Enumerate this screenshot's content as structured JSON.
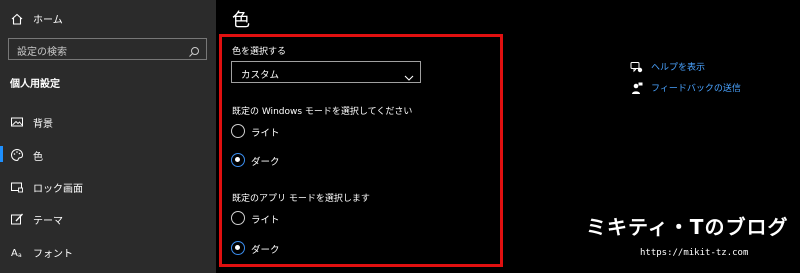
{
  "sidebar": {
    "home_label": "ホーム",
    "search_placeholder": "設定の検索",
    "section_title": "個人用設定",
    "items": [
      {
        "label": "背景",
        "icon": "image-icon"
      },
      {
        "label": "色",
        "icon": "palette-icon",
        "active": true
      },
      {
        "label": "ロック画面",
        "icon": "lock-screen-icon"
      },
      {
        "label": "テーマ",
        "icon": "theme-brush-icon"
      },
      {
        "label": "フォント",
        "icon": "font-icon"
      }
    ]
  },
  "main": {
    "title": "色",
    "choose_color_label": "色を選択する",
    "choose_color_value": "カスタム",
    "windows_mode_label": "既定の Windows モードを選択してください",
    "windows_mode_options": [
      "ライト",
      "ダーク"
    ],
    "windows_mode_selected": "ダーク",
    "app_mode_label": "既定のアプリ モードを選択します",
    "app_mode_options": [
      "ライト",
      "ダーク"
    ],
    "app_mode_selected": "ダーク"
  },
  "links": {
    "help": "ヘルプを表示",
    "feedback": "フィードバックの送信"
  },
  "watermark": {
    "title": "ミキティ・Tのブログ",
    "url": "https://mikit-tz.com"
  },
  "colors": {
    "sidebar_bg": "#2b2b2b",
    "main_bg": "#000000",
    "accent": "#3b8ef0",
    "link": "#4aa3ff",
    "highlight_border": "#e01010"
  }
}
